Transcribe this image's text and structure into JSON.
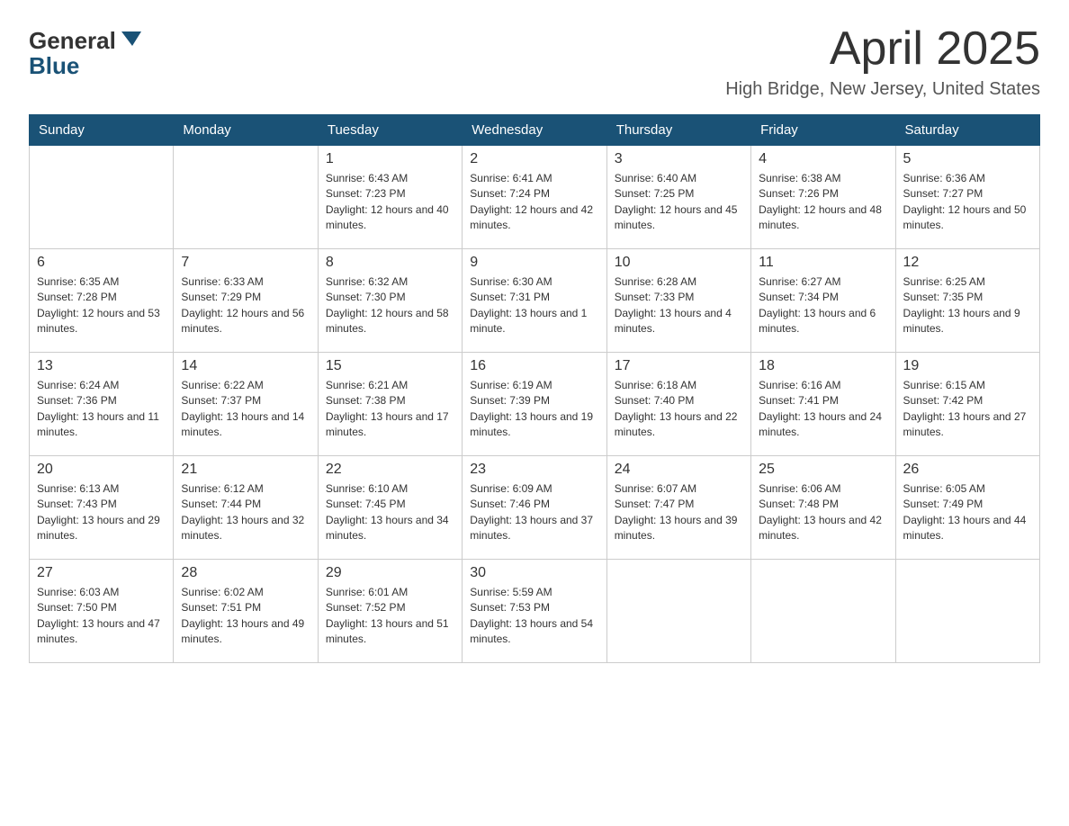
{
  "header": {
    "logo_general": "General",
    "logo_blue": "Blue",
    "title": "April 2025",
    "location": "High Bridge, New Jersey, United States"
  },
  "days_of_week": [
    "Sunday",
    "Monday",
    "Tuesday",
    "Wednesday",
    "Thursday",
    "Friday",
    "Saturday"
  ],
  "weeks": [
    [
      {
        "day": "",
        "sunrise": "",
        "sunset": "",
        "daylight": ""
      },
      {
        "day": "",
        "sunrise": "",
        "sunset": "",
        "daylight": ""
      },
      {
        "day": "1",
        "sunrise": "Sunrise: 6:43 AM",
        "sunset": "Sunset: 7:23 PM",
        "daylight": "Daylight: 12 hours and 40 minutes."
      },
      {
        "day": "2",
        "sunrise": "Sunrise: 6:41 AM",
        "sunset": "Sunset: 7:24 PM",
        "daylight": "Daylight: 12 hours and 42 minutes."
      },
      {
        "day": "3",
        "sunrise": "Sunrise: 6:40 AM",
        "sunset": "Sunset: 7:25 PM",
        "daylight": "Daylight: 12 hours and 45 minutes."
      },
      {
        "day": "4",
        "sunrise": "Sunrise: 6:38 AM",
        "sunset": "Sunset: 7:26 PM",
        "daylight": "Daylight: 12 hours and 48 minutes."
      },
      {
        "day": "5",
        "sunrise": "Sunrise: 6:36 AM",
        "sunset": "Sunset: 7:27 PM",
        "daylight": "Daylight: 12 hours and 50 minutes."
      }
    ],
    [
      {
        "day": "6",
        "sunrise": "Sunrise: 6:35 AM",
        "sunset": "Sunset: 7:28 PM",
        "daylight": "Daylight: 12 hours and 53 minutes."
      },
      {
        "day": "7",
        "sunrise": "Sunrise: 6:33 AM",
        "sunset": "Sunset: 7:29 PM",
        "daylight": "Daylight: 12 hours and 56 minutes."
      },
      {
        "day": "8",
        "sunrise": "Sunrise: 6:32 AM",
        "sunset": "Sunset: 7:30 PM",
        "daylight": "Daylight: 12 hours and 58 minutes."
      },
      {
        "day": "9",
        "sunrise": "Sunrise: 6:30 AM",
        "sunset": "Sunset: 7:31 PM",
        "daylight": "Daylight: 13 hours and 1 minute."
      },
      {
        "day": "10",
        "sunrise": "Sunrise: 6:28 AM",
        "sunset": "Sunset: 7:33 PM",
        "daylight": "Daylight: 13 hours and 4 minutes."
      },
      {
        "day": "11",
        "sunrise": "Sunrise: 6:27 AM",
        "sunset": "Sunset: 7:34 PM",
        "daylight": "Daylight: 13 hours and 6 minutes."
      },
      {
        "day": "12",
        "sunrise": "Sunrise: 6:25 AM",
        "sunset": "Sunset: 7:35 PM",
        "daylight": "Daylight: 13 hours and 9 minutes."
      }
    ],
    [
      {
        "day": "13",
        "sunrise": "Sunrise: 6:24 AM",
        "sunset": "Sunset: 7:36 PM",
        "daylight": "Daylight: 13 hours and 11 minutes."
      },
      {
        "day": "14",
        "sunrise": "Sunrise: 6:22 AM",
        "sunset": "Sunset: 7:37 PM",
        "daylight": "Daylight: 13 hours and 14 minutes."
      },
      {
        "day": "15",
        "sunrise": "Sunrise: 6:21 AM",
        "sunset": "Sunset: 7:38 PM",
        "daylight": "Daylight: 13 hours and 17 minutes."
      },
      {
        "day": "16",
        "sunrise": "Sunrise: 6:19 AM",
        "sunset": "Sunset: 7:39 PM",
        "daylight": "Daylight: 13 hours and 19 minutes."
      },
      {
        "day": "17",
        "sunrise": "Sunrise: 6:18 AM",
        "sunset": "Sunset: 7:40 PM",
        "daylight": "Daylight: 13 hours and 22 minutes."
      },
      {
        "day": "18",
        "sunrise": "Sunrise: 6:16 AM",
        "sunset": "Sunset: 7:41 PM",
        "daylight": "Daylight: 13 hours and 24 minutes."
      },
      {
        "day": "19",
        "sunrise": "Sunrise: 6:15 AM",
        "sunset": "Sunset: 7:42 PM",
        "daylight": "Daylight: 13 hours and 27 minutes."
      }
    ],
    [
      {
        "day": "20",
        "sunrise": "Sunrise: 6:13 AM",
        "sunset": "Sunset: 7:43 PM",
        "daylight": "Daylight: 13 hours and 29 minutes."
      },
      {
        "day": "21",
        "sunrise": "Sunrise: 6:12 AM",
        "sunset": "Sunset: 7:44 PM",
        "daylight": "Daylight: 13 hours and 32 minutes."
      },
      {
        "day": "22",
        "sunrise": "Sunrise: 6:10 AM",
        "sunset": "Sunset: 7:45 PM",
        "daylight": "Daylight: 13 hours and 34 minutes."
      },
      {
        "day": "23",
        "sunrise": "Sunrise: 6:09 AM",
        "sunset": "Sunset: 7:46 PM",
        "daylight": "Daylight: 13 hours and 37 minutes."
      },
      {
        "day": "24",
        "sunrise": "Sunrise: 6:07 AM",
        "sunset": "Sunset: 7:47 PM",
        "daylight": "Daylight: 13 hours and 39 minutes."
      },
      {
        "day": "25",
        "sunrise": "Sunrise: 6:06 AM",
        "sunset": "Sunset: 7:48 PM",
        "daylight": "Daylight: 13 hours and 42 minutes."
      },
      {
        "day": "26",
        "sunrise": "Sunrise: 6:05 AM",
        "sunset": "Sunset: 7:49 PM",
        "daylight": "Daylight: 13 hours and 44 minutes."
      }
    ],
    [
      {
        "day": "27",
        "sunrise": "Sunrise: 6:03 AM",
        "sunset": "Sunset: 7:50 PM",
        "daylight": "Daylight: 13 hours and 47 minutes."
      },
      {
        "day": "28",
        "sunrise": "Sunrise: 6:02 AM",
        "sunset": "Sunset: 7:51 PM",
        "daylight": "Daylight: 13 hours and 49 minutes."
      },
      {
        "day": "29",
        "sunrise": "Sunrise: 6:01 AM",
        "sunset": "Sunset: 7:52 PM",
        "daylight": "Daylight: 13 hours and 51 minutes."
      },
      {
        "day": "30",
        "sunrise": "Sunrise: 5:59 AM",
        "sunset": "Sunset: 7:53 PM",
        "daylight": "Daylight: 13 hours and 54 minutes."
      },
      {
        "day": "",
        "sunrise": "",
        "sunset": "",
        "daylight": ""
      },
      {
        "day": "",
        "sunrise": "",
        "sunset": "",
        "daylight": ""
      },
      {
        "day": "",
        "sunrise": "",
        "sunset": "",
        "daylight": ""
      }
    ]
  ]
}
